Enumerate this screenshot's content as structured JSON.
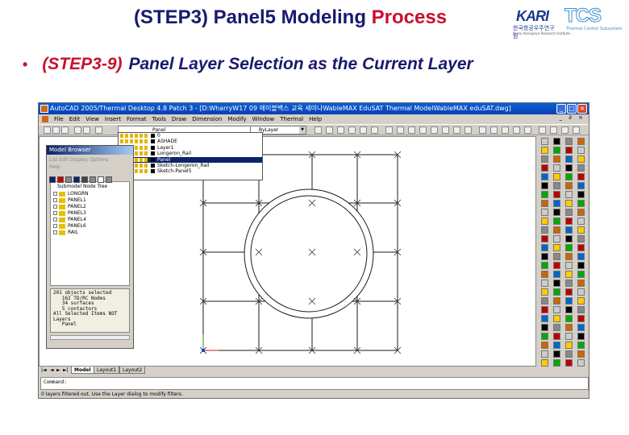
{
  "slide": {
    "title_prefix": "(STEP3) Panel5 Modeling ",
    "title_accent": "Process",
    "bullet_step": "(STEP3-9)",
    "bullet_desc": "Panel Layer Selection as the Current Layer",
    "logo_kari": "KARI",
    "logo_kari_korean": "한국항공우주연구원",
    "logo_kari_english": "Korea Aerospace Research Institute",
    "logo_tcs": "TCS",
    "logo_tcs_sub": "Thermal Control Subsystem"
  },
  "window": {
    "title": "AutoCAD 2005/Thermal Desktop 4.8 Patch 3 - [D:WharryW17 09 에이블백스 교육 세미나WableMAX EduSAT Thermal ModelWableMAX eduSAT.dwg]",
    "controls": [
      "_",
      "□",
      "×"
    ]
  },
  "menu": {
    "items": [
      "File",
      "Edit",
      "View",
      "Insert",
      "Format",
      "Tools",
      "Draw",
      "Dimension",
      "Modify",
      "Window",
      "Thermal",
      "Help"
    ],
    "doc_controls": "_ ∂ ×"
  },
  "toolbar": {
    "layer_value": "Panel",
    "linetype_value": "ByLayer"
  },
  "layers": {
    "items": [
      "0",
      "ASHADE",
      "Layer1",
      "Longeron_Rail",
      "Panel",
      "Sketch-Longeron_Rail",
      "Sketch-Panel5"
    ],
    "selected": "Panel"
  },
  "model_browser": {
    "title": "Model Browser",
    "menu_line1": "List  Edit  Display  Options",
    "menu_line2": "Help",
    "tree_header": "Submodel Node Tree",
    "tree_items": [
      "LONGRN",
      "PANEL1",
      "PANEL2",
      "PANEL3",
      "PANEL4",
      "PANEL6",
      "RAIL"
    ],
    "info_lines": [
      "201 objects selected",
      "   162 TD/RC Nodes",
      "   34 surfaces",
      "   5 contactors",
      "All Selected Items NOT",
      "Layers",
      "   Panel"
    ]
  },
  "tabs": {
    "items": [
      "Model",
      "Layout1",
      "Layout2"
    ],
    "active": "Model"
  },
  "command": {
    "prompt": "Command:"
  },
  "status": {
    "text": "0 layers filtered out.  Use the Layer dialog to modify filters."
  },
  "colors": {
    "title_blue": "#1a1a6e",
    "accent_red": "#c8102e",
    "titlebar": "#0a4fc8",
    "selection": "#0a246a"
  }
}
